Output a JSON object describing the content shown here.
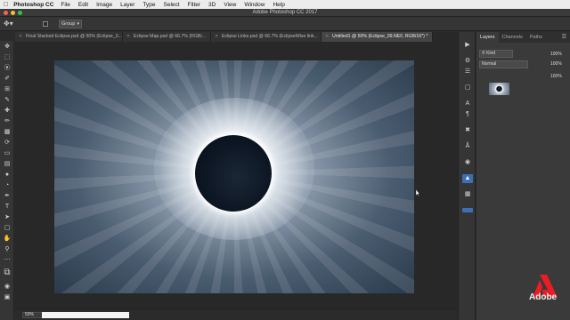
{
  "menubar": {
    "app_name": "Photoshop CC",
    "items": [
      "File",
      "Edit",
      "Image",
      "Layer",
      "Type",
      "Select",
      "Filter",
      "3D",
      "View",
      "Window",
      "Help"
    ]
  },
  "window": {
    "title": "Adobe Photoshop CC 2017"
  },
  "options": {
    "auto_select_target": "Group"
  },
  "tabs": [
    {
      "label": "Final Stacked Eclipse.psd @ 50% (Eclipse_0..."
    },
    {
      "label": "Eclipse Map.psd @ 66.7% (RGB/..."
    },
    {
      "label": "Eclipse Links.psd @ 66.7% (EclipseWise link..."
    },
    {
      "label": "Untitled1 @ 50% (Eclipse_09.NEF, RGB/16*) *",
      "active": true
    }
  ],
  "status": {
    "zoom": "50%"
  },
  "layers_panel": {
    "tabs": [
      "Layers",
      "Channels",
      "Paths"
    ],
    "filter": "Kind",
    "blend_mode": "Normal",
    "opacity": "100%",
    "fill": "100%",
    "percent_right": "100%"
  },
  "brand": {
    "logo_text": "Adobe",
    "accent": "#ed1c24"
  }
}
